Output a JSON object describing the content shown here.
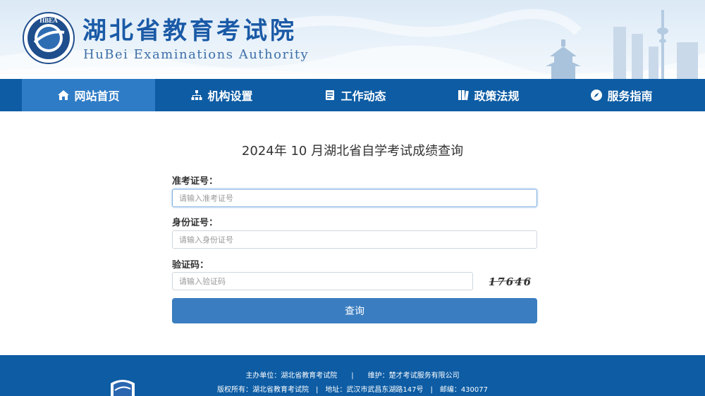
{
  "header": {
    "title": "湖北省教育考试院",
    "subtitle": "HuBei Examinations Authority",
    "logo_text": "HBEA",
    "logo_icon": "hbea-seal-logo"
  },
  "nav": {
    "items": [
      {
        "label": "网站首页",
        "icon": "home-icon"
      },
      {
        "label": "机构设置",
        "icon": "org-chart-icon"
      },
      {
        "label": "工作动态",
        "icon": "document-icon"
      },
      {
        "label": "政策法规",
        "icon": "books-icon"
      },
      {
        "label": "服务指南",
        "icon": "compass-icon"
      }
    ]
  },
  "form": {
    "title": "2024年 10 月湖北省自学考试成绩查询",
    "exam_id_label": "准考证号：",
    "exam_id_placeholder": "请输入准考证号",
    "id_card_label": "身份证号：",
    "id_card_placeholder": "请输入身份证号",
    "captcha_label": "验证码：",
    "captcha_placeholder": "请输入验证码",
    "captcha_image_text": "17646",
    "submit_label": "查询"
  },
  "footer": {
    "line1": "主办单位：湖北省教育考试院　　|　　维护：楚才考试服务有限公司",
    "line2": "版权所有：湖北省教育考试院　|　地址：武汉市武昌东湖路147号　|　邮编：430077"
  },
  "colors": {
    "primary": "#0d5ca4",
    "nav_active": "#2f7cc6",
    "button": "#3a7dc0",
    "title_text": "#1a5aa6"
  }
}
